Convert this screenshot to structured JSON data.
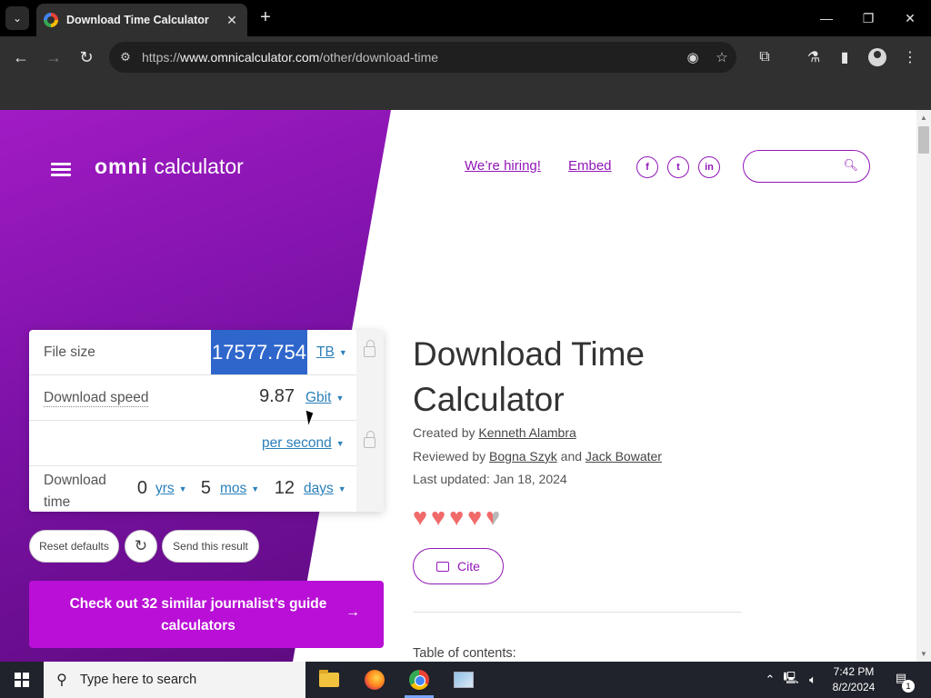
{
  "browser": {
    "tab_title": "Download Time Calculator",
    "tab_close": "✕",
    "new_tab": "+",
    "url_prefix": "https://",
    "url_domain": "www.omnicalculator.com",
    "url_path": "/other/download-time",
    "window_controls": {
      "minimize": "—",
      "maximize": "❐",
      "close": "✕"
    }
  },
  "site": {
    "logo_omni": "omni",
    "logo_calc": " calculator",
    "nav": {
      "hiring": "We’re hiring!",
      "embed": "Embed"
    },
    "social": {
      "facebook": "f",
      "twitter": "t",
      "linkedin": "in"
    }
  },
  "calculator": {
    "file_size": {
      "label": "File size",
      "value": "17577.754",
      "unit": "TB"
    },
    "download_speed": {
      "label": "Download speed",
      "value": "9.87",
      "unit": "Gbit",
      "per": "per second"
    },
    "download_time": {
      "label_line1": "Download",
      "label_line2": "time",
      "years": "0",
      "years_unit": "yrs",
      "months": "5",
      "months_unit": "mos",
      "days": "12",
      "days_unit": "days"
    },
    "caret": "▼",
    "reset_label": "Reset defaults",
    "send_label": "Send this result",
    "cta_label": "Check out 32 similar journalist’s guide calculators",
    "cta_arrow": "→"
  },
  "article": {
    "title": "Download Time Calculator",
    "created_by_prefix": "Created by ",
    "created_by": "Kenneth Alambra",
    "reviewed_by_prefix": "Reviewed by ",
    "reviewer_1": "Bogna Szyk",
    "reviewed_and": " and ",
    "reviewer_2": "Jack Bowater",
    "last_updated": "Last updated: Jan 18, 2024",
    "rating": 4.5,
    "cite_label": "Cite",
    "toc_label": "Table of contents:"
  },
  "taskbar": {
    "search_placeholder": "Type here to search",
    "time": "7:42 PM",
    "date": "8/2/2024",
    "notification_count": "1"
  }
}
